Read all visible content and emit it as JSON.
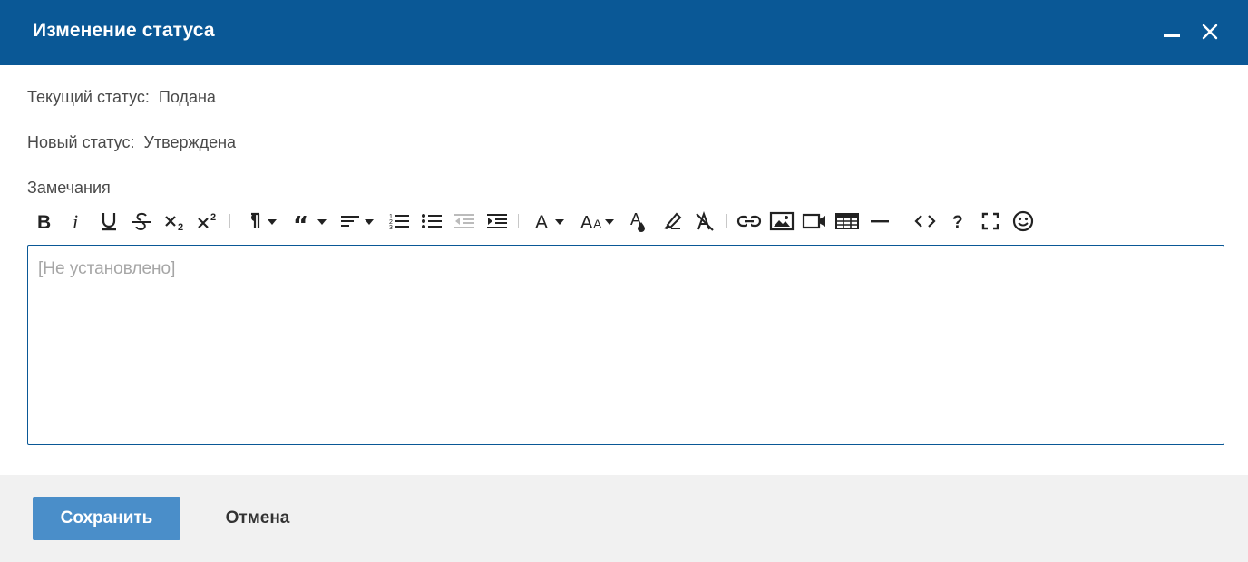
{
  "dialog": {
    "title": "Изменение статуса",
    "minimize_icon": "minimize-icon",
    "close_icon": "close-icon"
  },
  "fields": {
    "current_status_label": "Текущий статус:",
    "current_status_value": "Подана",
    "new_status_label": "Новый статус:",
    "new_status_value": "Утверждена",
    "notes_label": "Замечания"
  },
  "editor": {
    "placeholder": "[Не установлено]",
    "toolbar": [
      "bold-icon",
      "italic-icon",
      "underline-icon",
      "strikethrough-icon",
      "subscript-icon",
      "superscript-icon",
      "paragraph-format-icon",
      "quote-icon",
      "align-icon",
      "ordered-list-icon",
      "unordered-list-icon",
      "outdent-icon",
      "indent-icon",
      "font-family-icon",
      "font-size-icon",
      "text-color-icon",
      "highlight-icon",
      "clear-formatting-icon",
      "link-icon",
      "image-icon",
      "video-icon",
      "table-icon",
      "horizontal-line-icon",
      "code-view-icon",
      "help-icon",
      "fullscreen-icon",
      "emoticons-icon"
    ]
  },
  "footer": {
    "save_label": "Сохранить",
    "cancel_label": "Отмена"
  },
  "colors": {
    "header": "#0a5896",
    "primary_button": "#4a8ec9",
    "footer_bg": "#f1f1f1",
    "editor_border": "#0a5896"
  }
}
